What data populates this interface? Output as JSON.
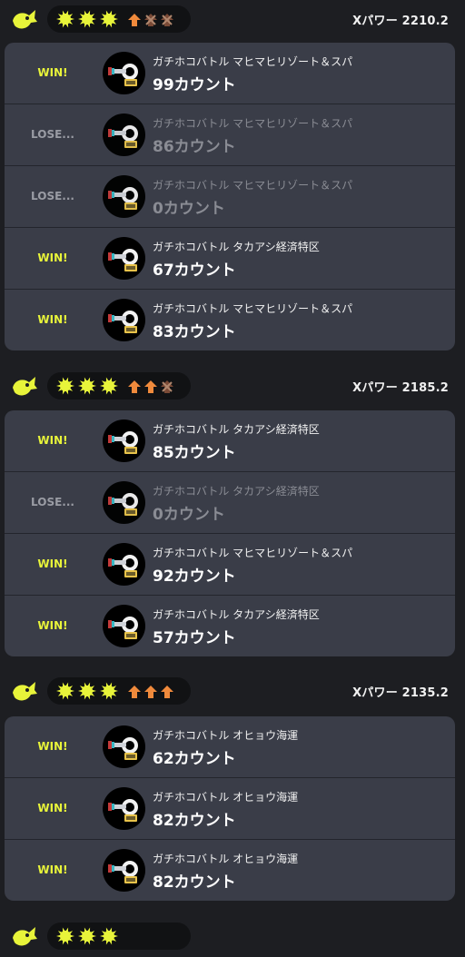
{
  "colors": {
    "win": "#e8f43a",
    "lose": "#9a9ca4",
    "streak_arrow": "#f08a3c",
    "burst": "#e8f43a"
  },
  "groups": [
    {
      "power": "Xパワー 2210.2",
      "badges": [
        "win",
        "win",
        "win"
      ],
      "arrows": [
        "up",
        "loss",
        "loss"
      ],
      "matches": [
        {
          "result": "WIN!",
          "outcome": "win",
          "mode": "ガチホコバトル マヒマヒリゾート＆スパ",
          "count": "99カウント"
        },
        {
          "result": "LOSE...",
          "outcome": "lose",
          "mode": "ガチホコバトル マヒマヒリゾート＆スパ",
          "count": "86カウント"
        },
        {
          "result": "LOSE...",
          "outcome": "lose",
          "mode": "ガチホコバトル マヒマヒリゾート＆スパ",
          "count": "0カウント"
        },
        {
          "result": "WIN!",
          "outcome": "win",
          "mode": "ガチホコバトル タカアシ経済特区",
          "count": "67カウント"
        },
        {
          "result": "WIN!",
          "outcome": "win",
          "mode": "ガチホコバトル マヒマヒリゾート＆スパ",
          "count": "83カウント"
        }
      ]
    },
    {
      "power": "Xパワー 2185.2",
      "badges": [
        "win",
        "win",
        "win"
      ],
      "arrows": [
        "up",
        "up",
        "loss"
      ],
      "matches": [
        {
          "result": "WIN!",
          "outcome": "win",
          "mode": "ガチホコバトル タカアシ経済特区",
          "count": "85カウント"
        },
        {
          "result": "LOSE...",
          "outcome": "lose",
          "mode": "ガチホコバトル タカアシ経済特区",
          "count": "0カウント"
        },
        {
          "result": "WIN!",
          "outcome": "win",
          "mode": "ガチホコバトル マヒマヒリゾート＆スパ",
          "count": "92カウント"
        },
        {
          "result": "WIN!",
          "outcome": "win",
          "mode": "ガチホコバトル タカアシ経済特区",
          "count": "57カウント"
        }
      ]
    },
    {
      "power": "Xパワー 2135.2",
      "badges": [
        "win",
        "win",
        "win"
      ],
      "arrows": [
        "up",
        "up",
        "up"
      ],
      "matches": [
        {
          "result": "WIN!",
          "outcome": "win",
          "mode": "ガチホコバトル オヒョウ海運",
          "count": "62カウント"
        },
        {
          "result": "WIN!",
          "outcome": "win",
          "mode": "ガチホコバトル オヒョウ海運",
          "count": "82カウント"
        },
        {
          "result": "WIN!",
          "outcome": "win",
          "mode": "ガチホコバトル オヒョウ海運",
          "count": "82カウント"
        }
      ]
    }
  ]
}
